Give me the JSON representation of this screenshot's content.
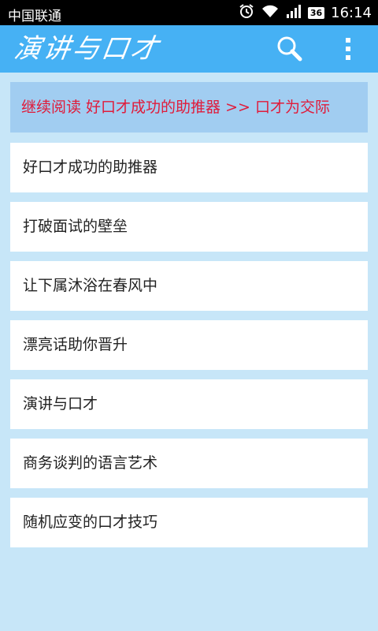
{
  "status_bar": {
    "carrier": "中国联通",
    "network_badge": "36",
    "time": "16:14",
    "icons": [
      "alarm-icon",
      "wifi-icon",
      "signal-icon"
    ]
  },
  "app_bar": {
    "title": "演讲与口才",
    "actions": [
      "search-icon",
      "overflow-menu-icon"
    ],
    "color": "#46b1f4"
  },
  "banner": {
    "text": "继续阅读 好口才成功的助推器 >> 口才为交际",
    "text_color": "#e01b3a"
  },
  "articles": [
    {
      "title": "好口才成功的助推器"
    },
    {
      "title": "打破面试的壁垒"
    },
    {
      "title": "让下属沐浴在春风中"
    },
    {
      "title": "漂亮话助你晋升"
    },
    {
      "title": "演讲与口才"
    },
    {
      "title": "商务谈判的语言艺术"
    },
    {
      "title": "随机应变的口才技巧"
    }
  ]
}
